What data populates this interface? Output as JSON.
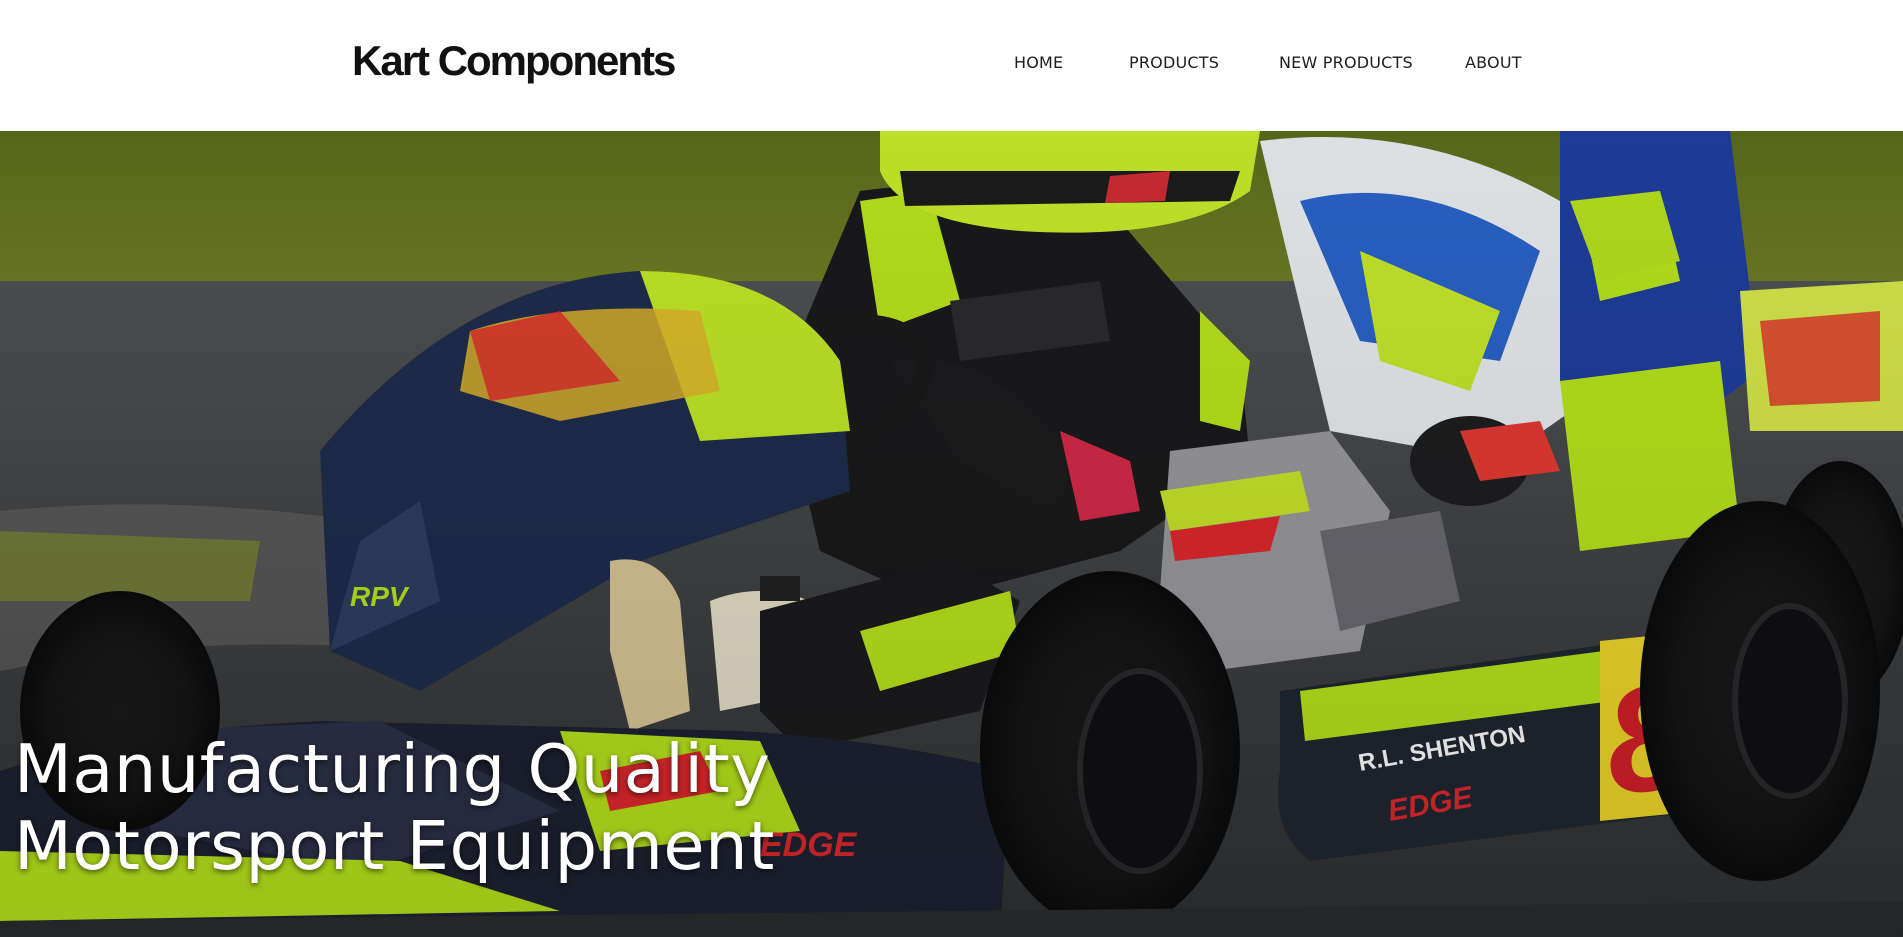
{
  "brand": {
    "logo_text": "Kart Components"
  },
  "nav": {
    "items": [
      {
        "label": "HOME"
      },
      {
        "label": "PRODUCTS"
      },
      {
        "label": "NEW PRODUCTS"
      },
      {
        "label": "ABOUT"
      }
    ]
  },
  "hero": {
    "headline_line1": "Manufacturing Quality",
    "headline_line2": "Motorsport Equipment",
    "image_alt": "Go-kart racers on track",
    "text_color": "#ffffff",
    "accent_lime": "#b8e51c",
    "accent_red": "#e0282c",
    "accent_yellow": "#f2d327"
  }
}
